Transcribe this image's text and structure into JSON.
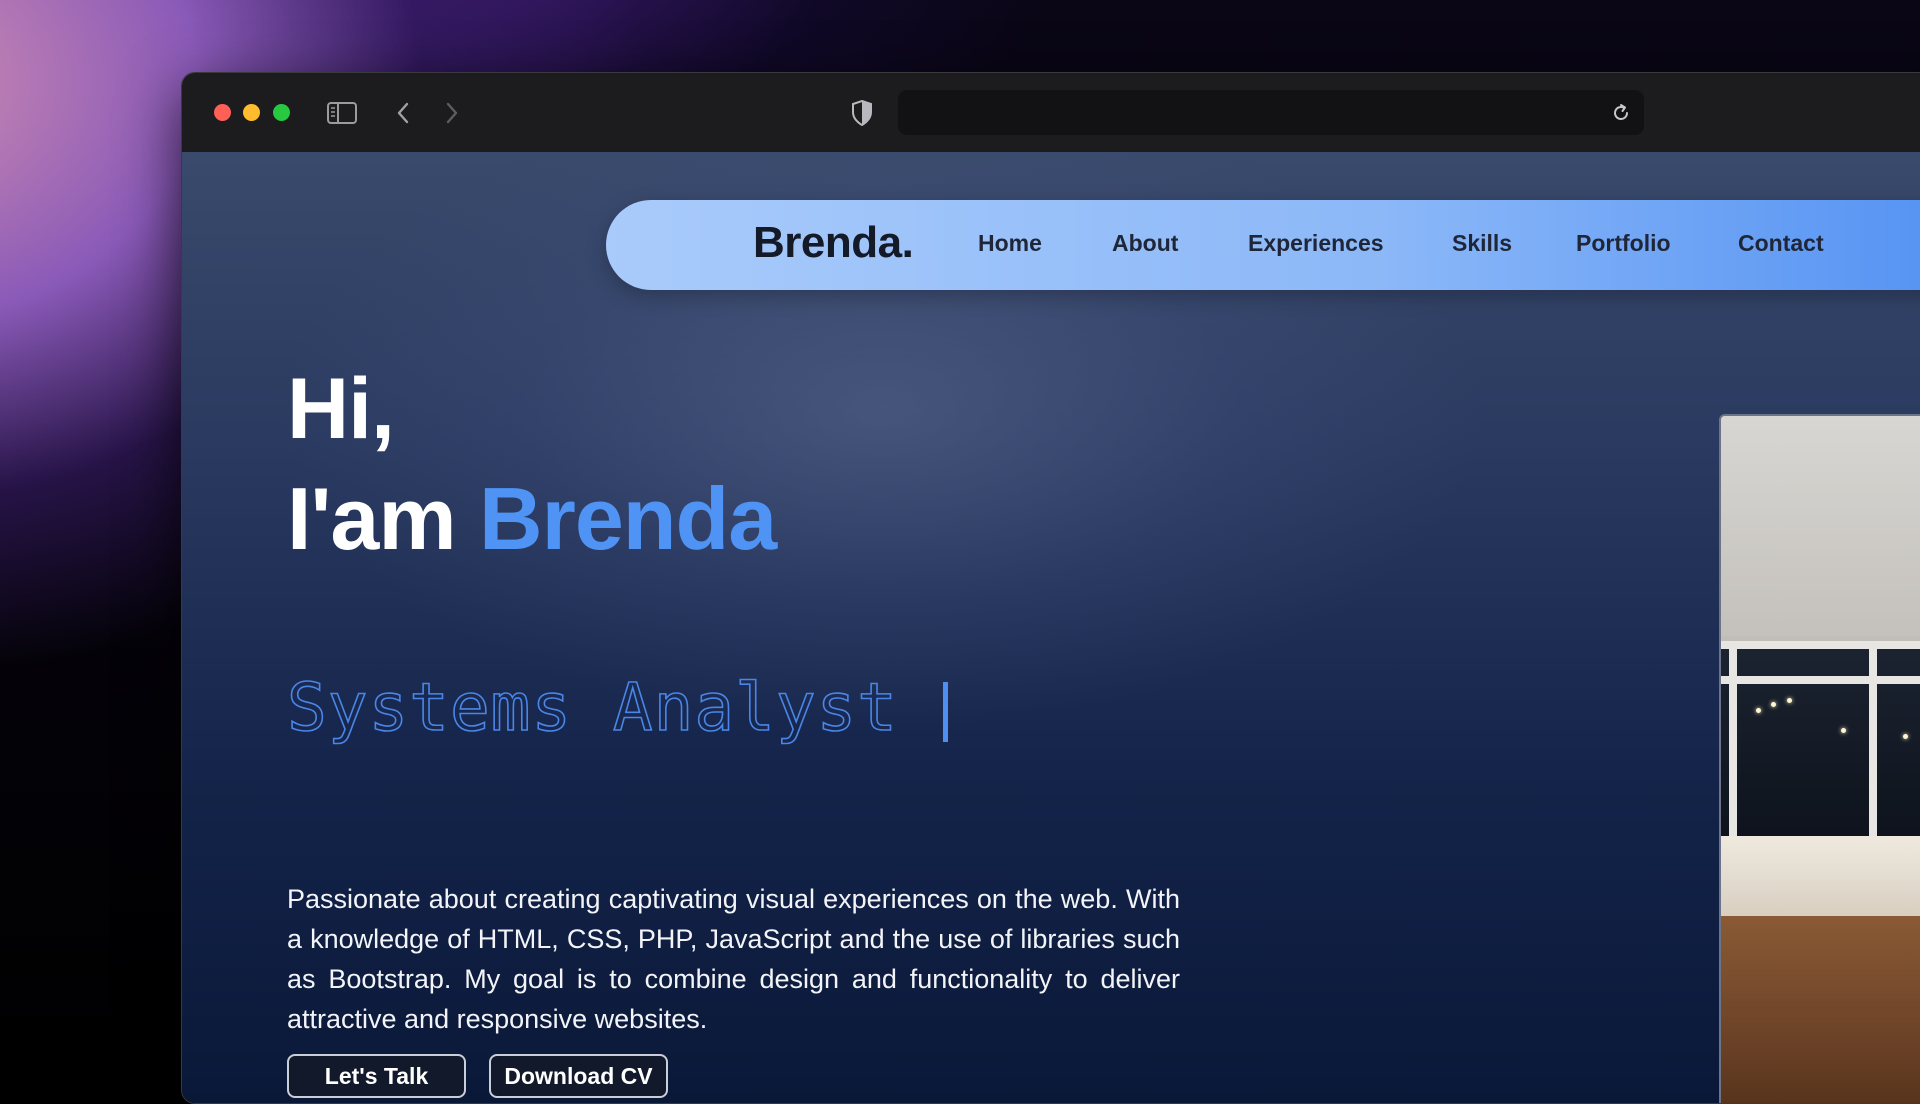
{
  "browser": {
    "url": "",
    "controls": {
      "close": "close",
      "minimize": "minimize",
      "maximize": "maximize"
    },
    "icons": [
      "sidebar-icon",
      "chevron-left-icon",
      "chevron-right-icon",
      "shield-icon",
      "reload-icon"
    ]
  },
  "nav": {
    "brand": "Brenda.",
    "items": [
      {
        "label": "Home"
      },
      {
        "label": "About"
      },
      {
        "label": "Experiences"
      },
      {
        "label": "Skills"
      },
      {
        "label": "Portfolio"
      },
      {
        "label": "Contact"
      }
    ]
  },
  "hero": {
    "greeting": "Hi,",
    "intro_prefix": "I'am",
    "name": "Brenda",
    "role": "Systems Analyst",
    "bio": "Passionate about creating captivating visual experiences on the web. With a knowledge of HTML, CSS, PHP, JavaScript and the use of libraries such as Bootstrap. My goal is to combine design and functionality to deliver attractive and responsive websites.",
    "buttons": {
      "talk": "Let's Talk",
      "cv": "Download CV"
    }
  },
  "colors": {
    "accent": "#4f94f5",
    "nav_gradient_start": "#a9cbfb",
    "nav_gradient_end": "#4f8ff2",
    "page_bg": "#14244a"
  }
}
